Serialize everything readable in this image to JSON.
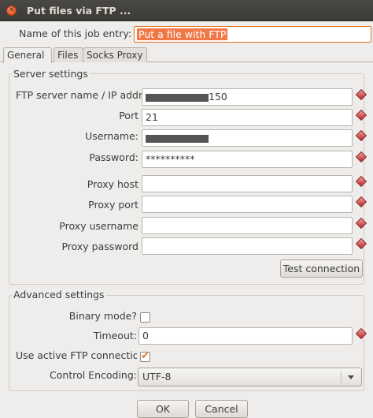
{
  "window": {
    "title": "Put files via FTP ..."
  },
  "job": {
    "label": "Name of this job entry:",
    "value": "Put a file with FTP"
  },
  "tabs": [
    {
      "label": "General"
    },
    {
      "label": "Files"
    },
    {
      "label": "Socks Proxy"
    }
  ],
  "server": {
    "title": "Server settings",
    "host": {
      "label": "FTP server name / IP addr",
      "value_suffix": "150"
    },
    "port": {
      "label": "Port",
      "value": "21"
    },
    "username": {
      "label": "Username:"
    },
    "password": {
      "label": "Password:",
      "value": "**********"
    },
    "proxy_host": {
      "label": "Proxy host",
      "value": ""
    },
    "proxy_port": {
      "label": "Proxy port",
      "value": ""
    },
    "proxy_username": {
      "label": "Proxy username",
      "value": ""
    },
    "proxy_password": {
      "label": "Proxy password",
      "value": ""
    },
    "test_button": "Test connection"
  },
  "advanced": {
    "title": "Advanced settings",
    "binary": {
      "label": "Binary mode?",
      "checked": false
    },
    "timeout": {
      "label": "Timeout:",
      "value": "0"
    },
    "active_ftp": {
      "label": "Use active FTP connectio",
      "checked": true
    },
    "encoding": {
      "label": "Control Encoding:",
      "value": "UTF-8"
    }
  },
  "buttons": {
    "ok": "OK",
    "cancel": "Cancel"
  },
  "colors": {
    "accent": "#f07746",
    "required": "#b8262a",
    "titlebar": "#3c3b37"
  }
}
